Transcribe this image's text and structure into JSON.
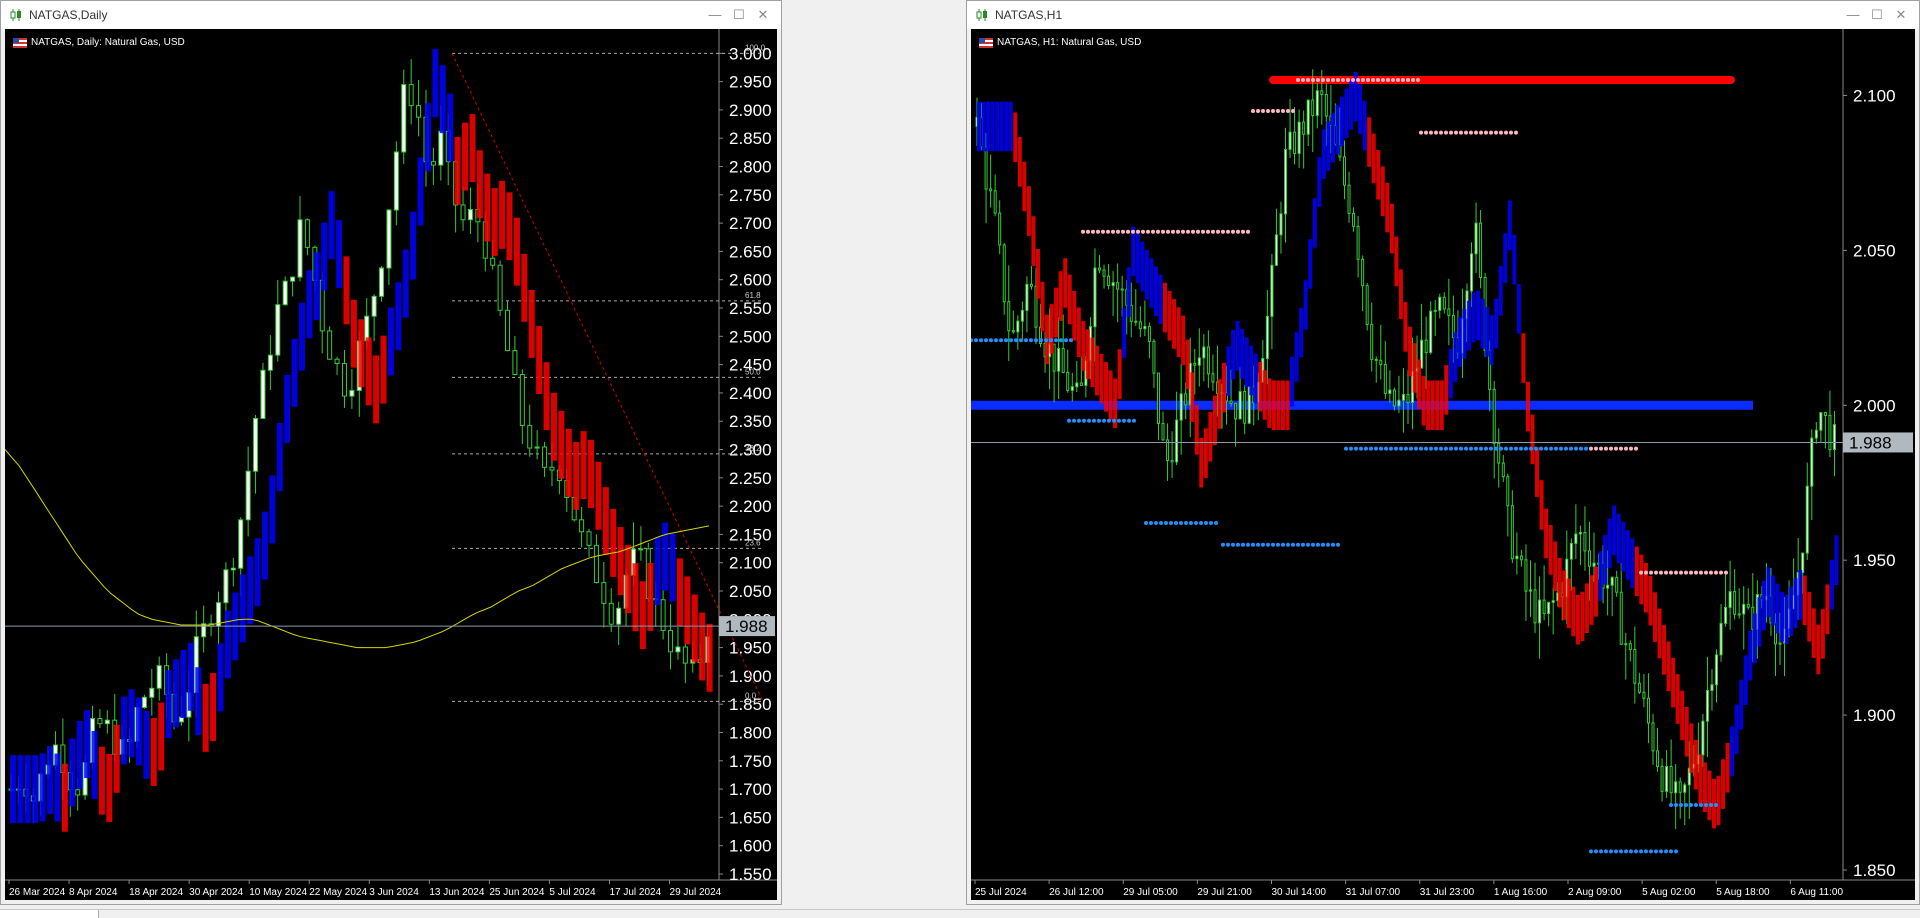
{
  "windows": [
    {
      "title": "NATGAS,Daily",
      "symbol_label": "NATGAS, Daily:  Natural Gas, USD",
      "current_price": "1.988",
      "y_ticks": [
        "3.000",
        "2.950",
        "2.900",
        "2.850",
        "2.800",
        "2.750",
        "2.700",
        "2.650",
        "2.600",
        "2.550",
        "2.500",
        "2.450",
        "2.400",
        "2.350",
        "2.300",
        "2.250",
        "2.200",
        "2.150",
        "2.100",
        "2.050",
        "2.000",
        "1.950",
        "1.900",
        "1.850",
        "1.800",
        "1.750",
        "1.700",
        "1.650",
        "1.600",
        "1.550"
      ],
      "x_ticks": [
        "26 Mar 2024",
        "8 Apr 2024",
        "18 Apr 2024",
        "30 Apr 2024",
        "10 May 2024",
        "22 May 2024",
        "3 Jun 2024",
        "13 Jun 2024",
        "25 Jun 2024",
        "5 Jul 2024",
        "17 Jul 2024",
        "29 Jul 2024"
      ],
      "fib_labels": [
        "100.0",
        "61.8",
        "50.0",
        "38.2",
        "23.6",
        "0.0"
      ]
    },
    {
      "title": "NATGAS,H1",
      "symbol_label": "NATGAS, H1:  Natural Gas, USD",
      "current_price": "1.988",
      "y_ticks": [
        "2.100",
        "2.050",
        "2.000",
        "1.950",
        "1.900",
        "1.850"
      ],
      "x_ticks": [
        "25 Jul 2024",
        "26 Jul 12:00",
        "29 Jul 05:00",
        "29 Jul 21:00",
        "30 Jul 14:00",
        "31 Jul 07:00",
        "31 Jul 23:00",
        "1 Aug 16:00",
        "2 Aug 09:00",
        "5 Aug 02:00",
        "5 Aug 18:00",
        "6 Aug 11:00"
      ]
    }
  ],
  "colors": {
    "background": "#000000",
    "bull_candle": "#33cc33",
    "bull_body": "#ffffff",
    "trend_up": "#0000ff",
    "trend_down": "#ff0000",
    "ma_line": "#d4d400",
    "support_dots": "#1e90ff",
    "resistance_dots": "#ffb6c1"
  },
  "chart_data": [
    {
      "type": "candlestick",
      "title": "NATGAS, Daily:  Natural Gas, USD",
      "ylim": [
        1.55,
        3.02
      ],
      "current_price": 1.988,
      "fibonacci": {
        "high": 3.0,
        "low": 1.855,
        "levels": [
          100.0,
          61.8,
          50.0,
          38.2,
          23.6,
          0.0
        ]
      },
      "close_path": [
        1.7,
        1.72,
        1.68,
        1.75,
        1.78,
        1.72,
        1.7,
        1.8,
        1.82,
        1.78,
        1.76,
        1.85,
        1.88,
        1.9,
        1.82,
        1.85,
        1.95,
        2.0,
        2.05,
        2.1,
        2.2,
        2.35,
        2.45,
        2.55,
        2.6,
        2.7,
        2.62,
        2.5,
        2.45,
        2.4,
        2.48,
        2.55,
        2.65,
        2.8,
        2.95,
        2.9,
        2.78,
        2.85,
        2.75,
        2.7,
        2.72,
        2.65,
        2.55,
        2.45,
        2.35,
        2.3,
        2.25,
        2.28,
        2.22,
        2.15,
        2.1,
        2.05,
        2.0,
        2.08,
        2.12,
        2.05,
        2.0,
        1.95,
        1.92,
        1.9,
        1.988
      ],
      "ma_path": [
        2.3,
        2.27,
        2.23,
        2.19,
        2.15,
        2.11,
        2.08,
        2.05,
        2.03,
        2.01,
        2.0,
        1.995,
        1.99,
        1.99,
        1.99,
        1.995,
        2.0,
        2.0,
        1.99,
        1.98,
        1.97,
        1.965,
        1.96,
        1.955,
        1.95,
        1.95,
        1.95,
        1.955,
        1.96,
        1.97,
        1.98,
        1.995,
        2.01,
        2.02,
        2.035,
        2.05,
        2.06,
        2.075,
        2.09,
        2.1,
        2.11,
        2.115,
        2.12,
        2.13,
        2.14,
        2.15,
        2.155,
        2.16,
        2.165
      ]
    },
    {
      "type": "candlestick",
      "title": "NATGAS, H1:  Natural Gas, USD",
      "ylim": [
        1.85,
        2.115
      ],
      "current_price": 1.988,
      "horizontal_lines": [
        {
          "price": 2.0,
          "color": "blue"
        },
        {
          "price": 2.105,
          "color": "red"
        }
      ],
      "close_path": [
        2.09,
        2.06,
        2.02,
        2.04,
        2.02,
        2.01,
        2.0,
        2.05,
        2.04,
        2.03,
        2.02,
        1.98,
        2.0,
        2.02,
        2.01,
        2.0,
        2.0,
        2.03,
        2.08,
        2.09,
        2.1,
        2.08,
        2.06,
        2.02,
        2.0,
        2.0,
        2.02,
        2.03,
        2.02,
        2.06,
        2.0,
        1.96,
        1.94,
        1.93,
        1.94,
        1.96,
        1.95,
        1.94,
        1.92,
        1.9,
        1.88,
        1.87,
        1.89,
        1.92,
        1.94,
        1.93,
        1.94,
        1.92,
        1.95,
        2.0,
        1.988
      ]
    }
  ]
}
